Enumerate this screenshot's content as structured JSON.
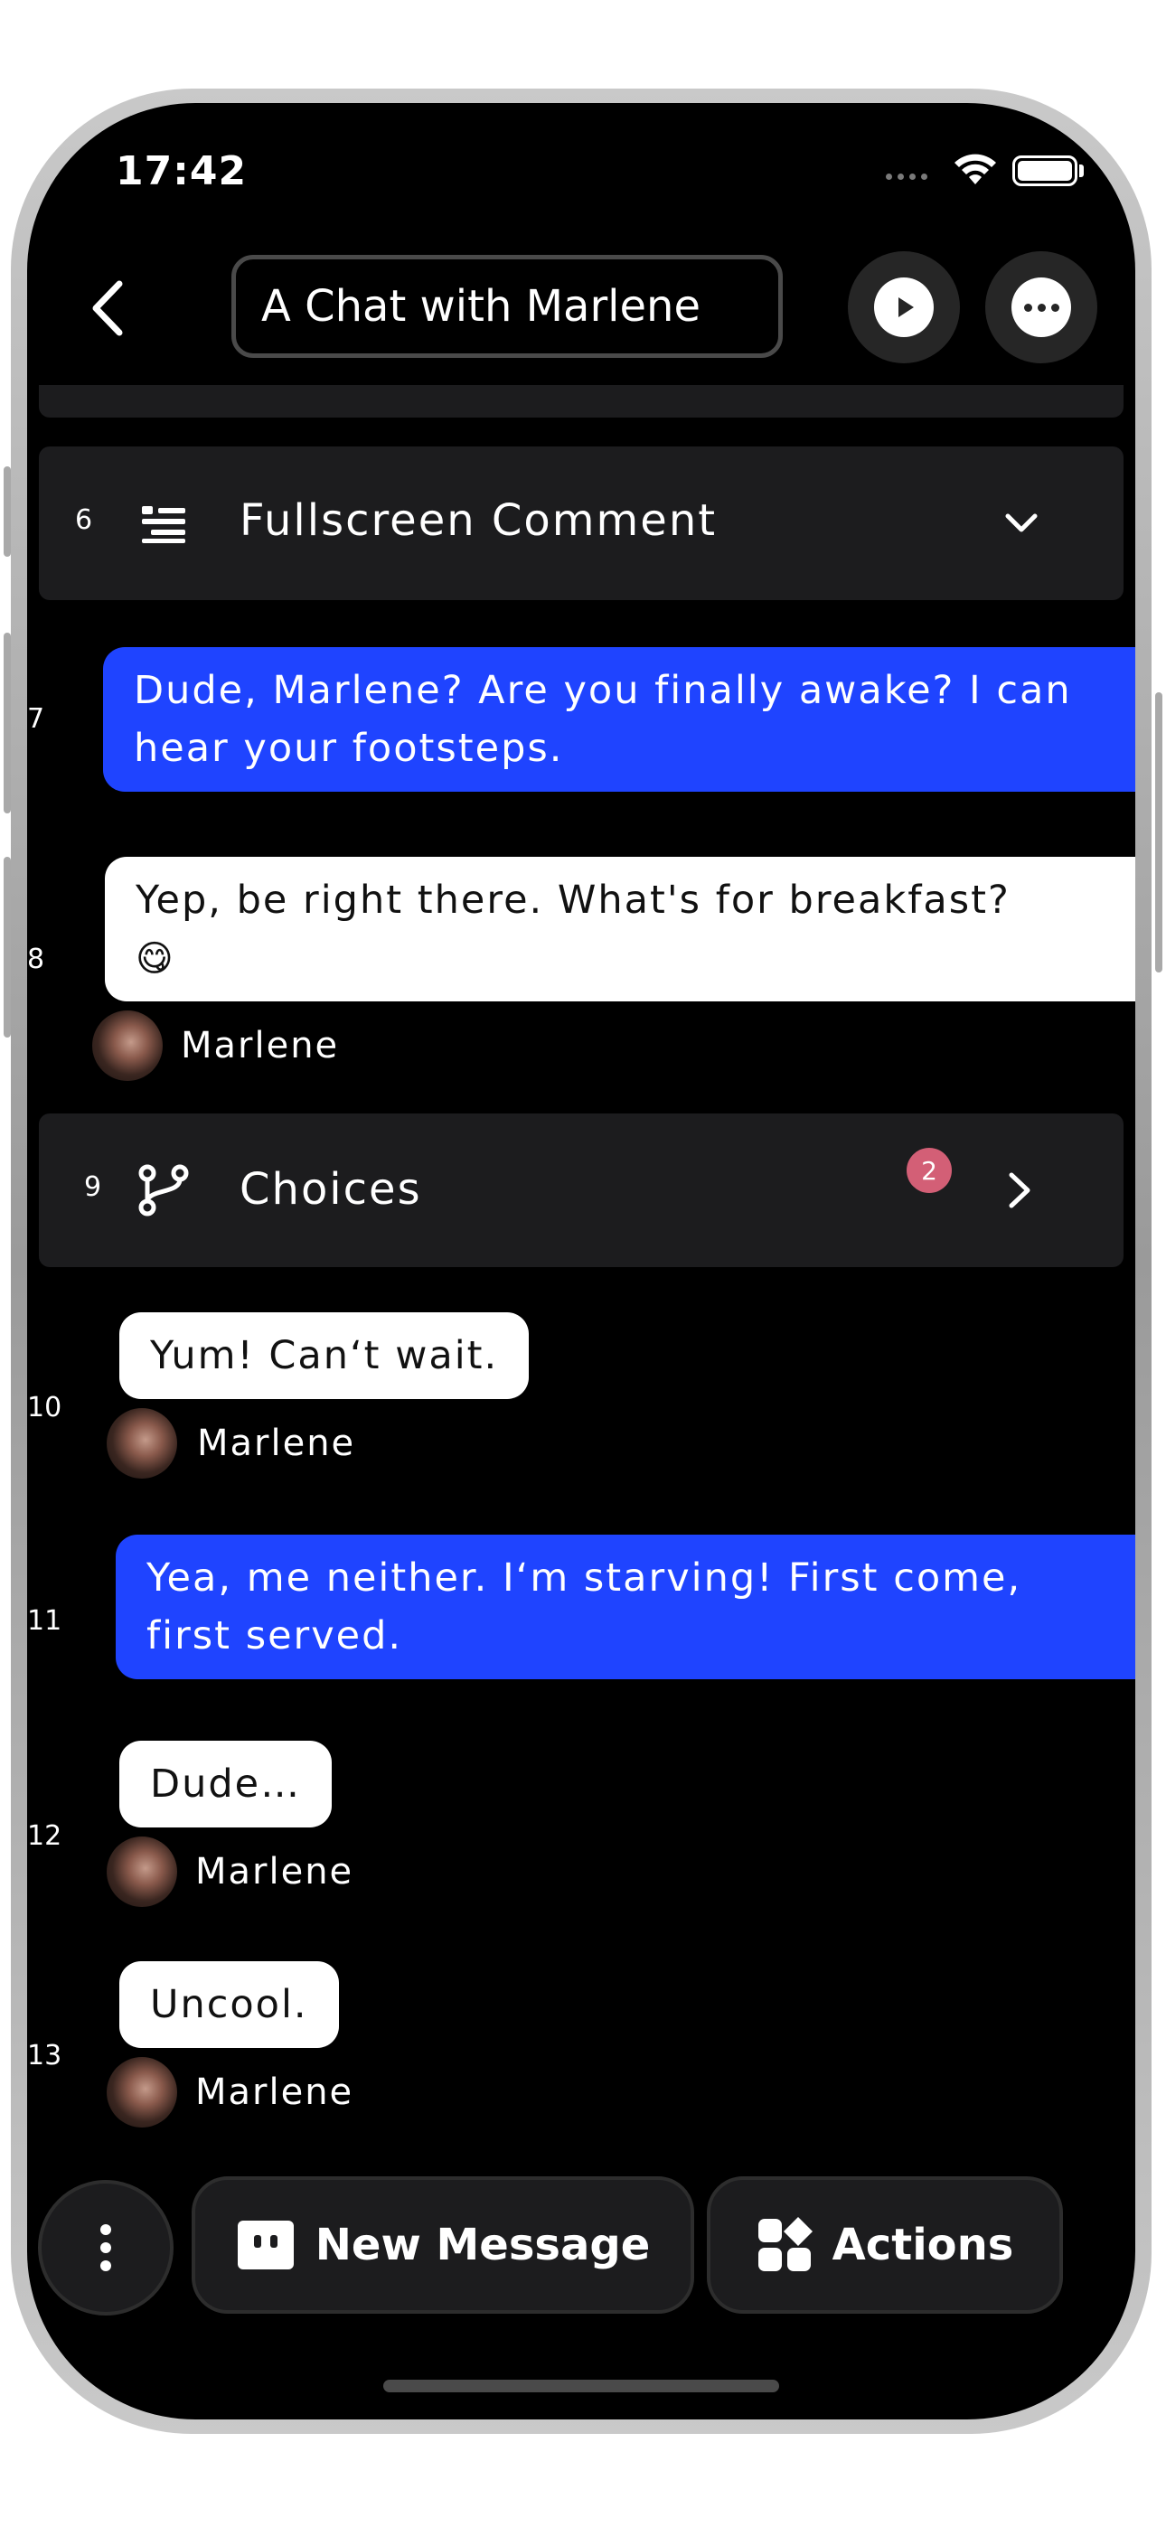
{
  "status_bar": {
    "time": "17:42"
  },
  "header": {
    "title": "A Chat with Marlene"
  },
  "rows": {
    "fullscreen_comment": {
      "number": "6",
      "label": "Fullscreen Comment"
    },
    "msg7": {
      "number": "7",
      "text": "Dude, Marlene? Are you finally awake? I can hear your footsteps."
    },
    "msg8": {
      "number": "8",
      "text": "Yep, be right there. What's for breakfast?",
      "emoji": "😋",
      "sender": "Marlene"
    },
    "choices": {
      "number": "9",
      "label": "Choices",
      "badge": "2"
    },
    "msg10": {
      "number": "10",
      "text": "Yum! Can‘t wait.",
      "sender": "Marlene"
    },
    "msg11": {
      "number": "11",
      "text": "Yea, me neither. I‘m starving! First come, first served."
    },
    "msg12": {
      "number": "12",
      "text": "Dude…",
      "sender": "Marlene"
    },
    "msg13": {
      "number": "13",
      "text": "Uncool.",
      "sender": "Marlene"
    }
  },
  "bottom_bar": {
    "new_message_label": "New Message",
    "actions_label": "Actions"
  },
  "colors": {
    "accent_blue": "#1f44ff",
    "badge_pink": "#d35f76",
    "card_bg": "#1c1c1e",
    "screen_bg": "#000000"
  },
  "icons": {
    "back": "chevron-left-icon",
    "play": "play-icon",
    "more": "ellipsis-icon",
    "comment": "fullscreen-comment-icon",
    "expand": "chevron-down-icon",
    "choices": "branch-icon",
    "open": "chevron-right-icon",
    "menu": "vertical-ellipsis-icon",
    "new_message": "chat-bubble-icon",
    "actions": "grid-shapes-icon"
  }
}
